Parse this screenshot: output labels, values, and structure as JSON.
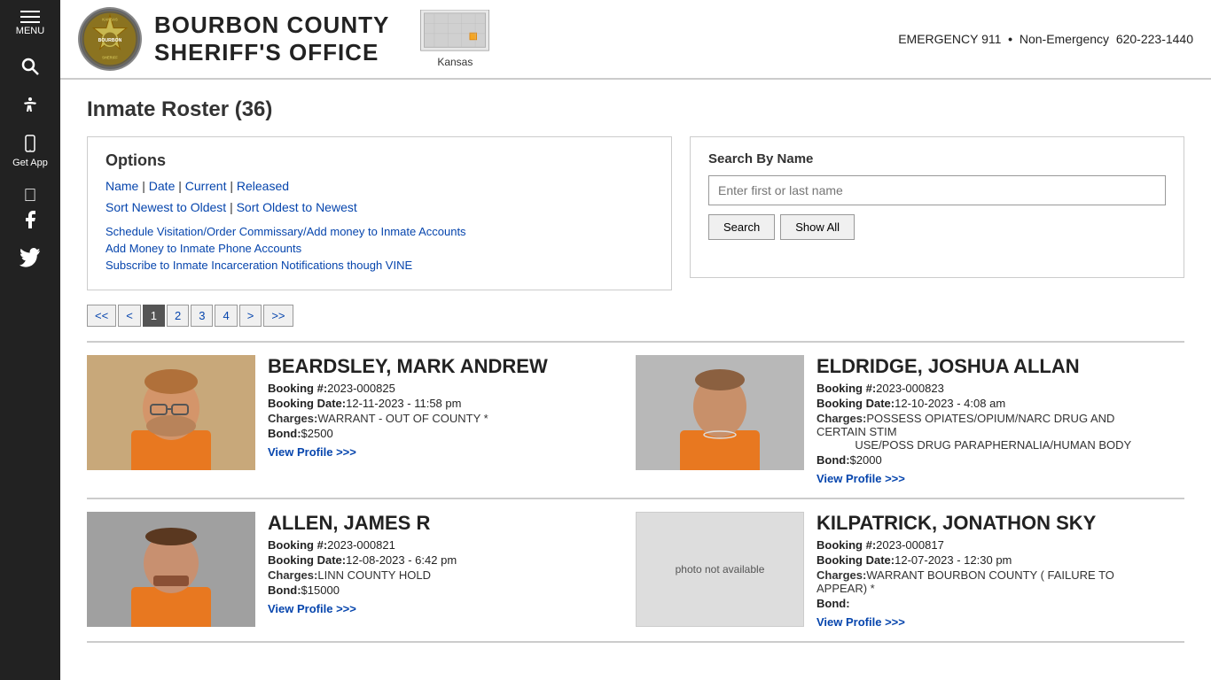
{
  "site": {
    "title1": "BOURBON COUNTY",
    "title2": "SHERIFF'S OFFICE",
    "state": "Kansas",
    "emergency": "EMERGENCY 911",
    "nonemergency_label": "Non-Emergency",
    "nonemergency_phone": "620-223-1440"
  },
  "sidebar": {
    "menu_label": "MENU",
    "get_app_label": "Get App"
  },
  "page": {
    "title": "Inmate Roster (36)"
  },
  "options": {
    "title": "Options",
    "filter_name": "Name",
    "filter_date": "Date",
    "filter_current": "Current",
    "filter_released": "Released",
    "sort_newest": "Sort Newest to Oldest",
    "sort_oldest": "Sort Oldest to Newest",
    "link1": "Schedule Visitation/Order Commissary/Add money to Inmate Accounts",
    "link2": "Add Money to Inmate Phone Accounts",
    "link3": "Subscribe to Inmate Incarceration Notifications though VINE"
  },
  "search": {
    "title": "Search By Name",
    "placeholder": "Enter first or last name",
    "search_label": "Search",
    "show_all_label": "Show All"
  },
  "pagination": {
    "first": "<<",
    "prev": "<",
    "pages": [
      "1",
      "2",
      "3",
      "4"
    ],
    "active_page": "1",
    "next": ">",
    "last": ">>"
  },
  "inmates": [
    {
      "id": "beardsley",
      "name": "BEARDSLEY, MARK ANDREW",
      "booking_label": "Booking #:",
      "booking_num": "2023-000825",
      "booking_date_label": "Booking Date:",
      "booking_date": "12-11-2023 - 11:58 pm",
      "charges_label": "Charges:",
      "charges": "WARRANT - OUT OF COUNTY *",
      "bond_label": "Bond:",
      "bond": "$2500",
      "view_profile": "View Profile >>>",
      "has_photo": true,
      "photo_bg": "#c8a87a"
    },
    {
      "id": "eldridge",
      "name": "ELDRIDGE, JOSHUA ALLAN",
      "booking_label": "Booking #:",
      "booking_num": "2023-000823",
      "booking_date_label": "Booking Date:",
      "booking_date": "12-10-2023 - 4:08 am",
      "charges_label": "Charges:",
      "charges": "POSSESS OPIATES/OPIUM/NARC DRUG AND CERTAIN STIM\nUSE/POSS DRUG PARAPHERNALIA/HUMAN BODY",
      "bond_label": "Bond:",
      "bond": "$2000",
      "view_profile": "View Profile >>>",
      "has_photo": true,
      "photo_bg": "#d0a060"
    },
    {
      "id": "allen",
      "name": "ALLEN, JAMES R",
      "booking_label": "Booking #:",
      "booking_num": "2023-000821",
      "booking_date_label": "Booking Date:",
      "booking_date": "12-08-2023 - 6:42 pm",
      "charges_label": "Charges:",
      "charges": "LINN COUNTY HOLD",
      "bond_label": "Bond:",
      "bond": "$15000",
      "view_profile": "View Profile >>>",
      "has_photo": true,
      "photo_bg": "#b89070"
    },
    {
      "id": "kilpatrick",
      "name": "KILPATRICK, JONATHON SKY",
      "booking_label": "Booking #:",
      "booking_num": "2023-000817",
      "booking_date_label": "Booking Date:",
      "booking_date": "12-07-2023 - 12:30 pm",
      "charges_label": "Charges:",
      "charges": "WARRANT BOURBON COUNTY ( FAILURE TO APPEAR) *",
      "bond_label": "Bond:",
      "bond": "",
      "view_profile": "View Profile >>>",
      "has_photo": false,
      "photo_placeholder": "photo not available"
    }
  ]
}
